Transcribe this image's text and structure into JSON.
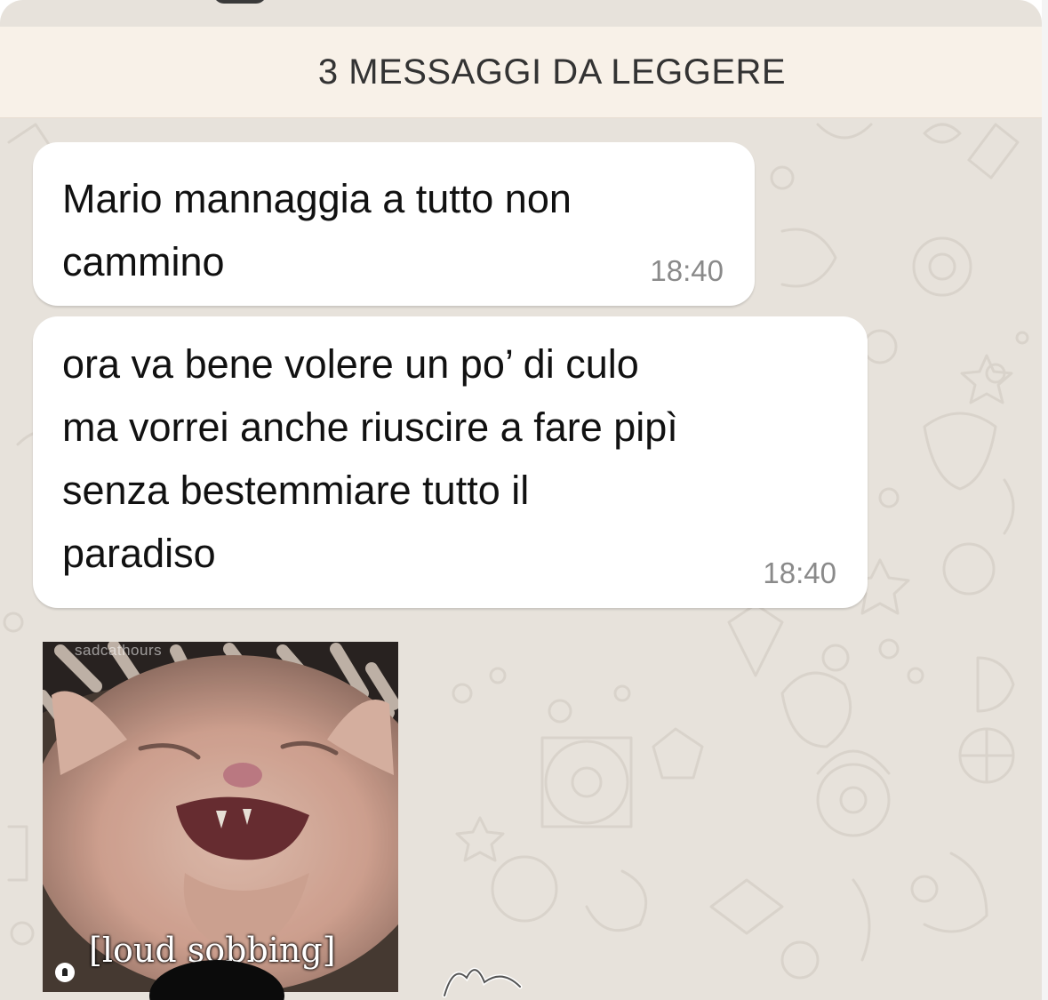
{
  "unread_banner": {
    "text": "3 MESSAGGI DA LEGGERE"
  },
  "messages": [
    {
      "text": "Mario mannaggia a tutto non\ncammino",
      "time": "18:40"
    },
    {
      "text": "ora va bene volere un po’ di culo\nma vorrei anche riuscire a fare pipì\nsenza bestemmiare tutto il\nparadiso",
      "time": "18:40"
    }
  ],
  "gif": {
    "watermark": "sadcathours",
    "caption": "[loud sobbing]"
  },
  "colors": {
    "chat_background": "#e7e2db",
    "banner_background": "#f8f1e8",
    "bubble": "#ffffff",
    "timestamp": "#8a8a8a"
  },
  "icons": [
    "sender-avatar-icon",
    "sticker-doodle-icon"
  ]
}
